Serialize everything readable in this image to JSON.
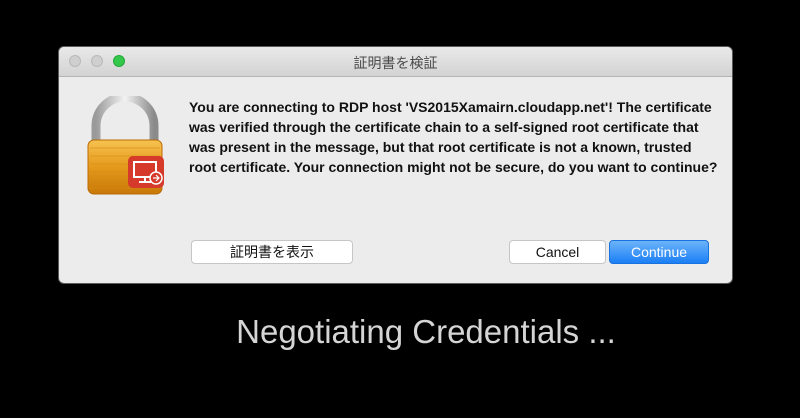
{
  "dialog": {
    "title": "証明書を検証",
    "message": "You are connecting to RDP host 'VS2015Xamairn.cloudapp.net'! The certificate was verified through the certificate chain to a self-signed root certificate that was present in the message, but that root certificate is not a known, trusted root certificate. Your connection might not be secure, do you want to continue?",
    "buttons": {
      "show_certificate": "証明書を表示",
      "cancel": "Cancel",
      "continue": "Continue"
    },
    "icon": "lock-with-remote-desktop-badge-icon"
  },
  "status_text": "Negotiating Credentials ...",
  "colors": {
    "background": "#000000",
    "dialog_bg": "#ececec",
    "accent_button": "#1b7ff5",
    "zoom_button": "#34c84a"
  }
}
